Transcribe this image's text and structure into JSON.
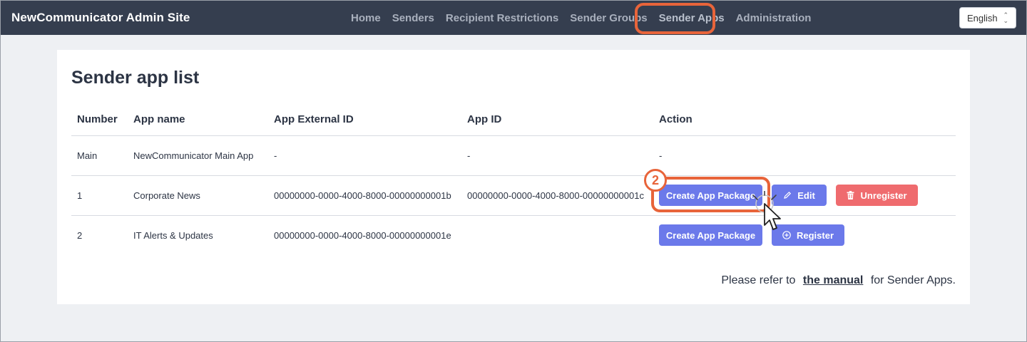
{
  "header": {
    "brand": "NewCommunicator Admin Site",
    "nav": [
      {
        "label": "Home"
      },
      {
        "label": "Senders"
      },
      {
        "label": "Recipient Restrictions"
      },
      {
        "label": "Sender Groups"
      },
      {
        "label": "Sender Apps",
        "active": true
      },
      {
        "label": "Administration"
      }
    ],
    "language": "English"
  },
  "main": {
    "title": "Sender app list",
    "columns": [
      "Number",
      "App name",
      "App External ID",
      "App ID",
      "Action"
    ],
    "rows": [
      {
        "number": "Main",
        "app_name": "NewCommunicator Main App",
        "external_id": "-",
        "app_id": "-",
        "action": "-"
      },
      {
        "number": "1",
        "app_name": "Corporate News",
        "external_id": "00000000-0000-4000-8000-00000000001b",
        "app_id": "00000000-0000-4000-8000-00000000001c",
        "buttons": {
          "create": "Create App Package",
          "edit": "Edit",
          "unregister": "Unregister"
        }
      },
      {
        "number": "2",
        "app_name": "IT Alerts & Updates",
        "external_id": "00000000-0000-4000-8000-00000000001e",
        "app_id": "",
        "buttons": {
          "create": "Create App Package",
          "register": "Register"
        }
      }
    ],
    "footer": {
      "before": "Please refer to",
      "link": "the manual",
      "after": "for Sender Apps."
    }
  },
  "annotation": {
    "step": "2",
    "color": "#e8643a"
  },
  "colors": {
    "topbar": "#353e4f",
    "primary": "#6b79ea",
    "danger": "#ef6b6e",
    "background": "#eef0f3"
  }
}
